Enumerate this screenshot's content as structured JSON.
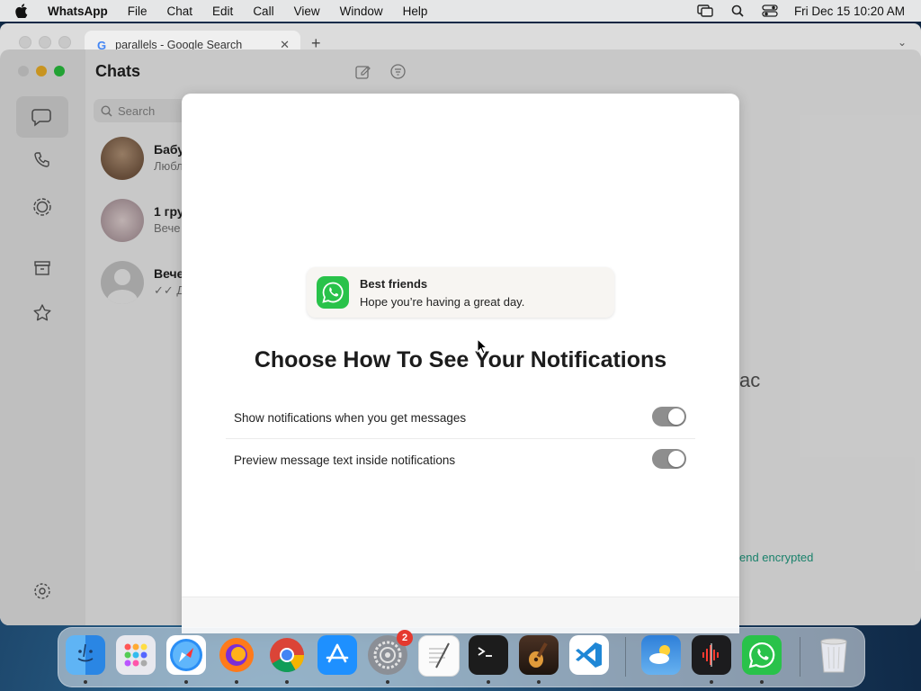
{
  "menubar": {
    "app_name": "WhatsApp",
    "menus": [
      "File",
      "Chat",
      "Edit",
      "Call",
      "View",
      "Window",
      "Help"
    ],
    "clock": "Fri Dec 15  10:20 AM"
  },
  "browser": {
    "tab_title": "parallels - Google Search",
    "tab_favicon": "G"
  },
  "whatsapp": {
    "title": "Chats",
    "search_placeholder": "Search",
    "chats": [
      {
        "name": "Бабу",
        "preview": "Любл"
      },
      {
        "name": "1 гру",
        "preview": "Вече"
      },
      {
        "name": "Вече",
        "preview": "✓✓ Д"
      }
    ],
    "right_text": "ac",
    "encrypted_text": "end encrypted"
  },
  "modal": {
    "notification": {
      "title": "Best friends",
      "body": "Hope you’re having a great day."
    },
    "heading": "Choose How To See Your Notifications",
    "options": [
      {
        "label": "Show notifications when you get messages",
        "enabled": true
      },
      {
        "label": "Preview message text inside notifications",
        "enabled": true
      }
    ]
  },
  "dock": {
    "settings_badge": "2",
    "apps": [
      "Finder",
      "Launchpad",
      "Safari",
      "Firefox",
      "Chrome",
      "App Store",
      "System Settings",
      "TextEdit",
      "Terminal",
      "GarageBand",
      "VS Code",
      "Weather",
      "Voice Memos",
      "WhatsApp",
      "Trash"
    ]
  },
  "colors": {
    "whatsapp_green": "#29c24a",
    "toggle_gray": "#8e8e8e",
    "encrypted_green": "#1f9e83"
  }
}
